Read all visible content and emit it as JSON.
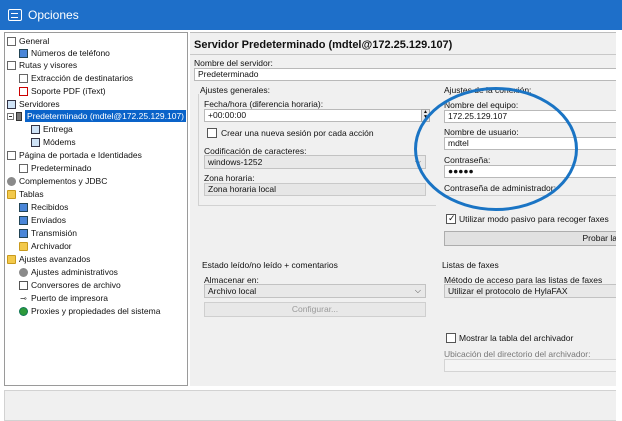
{
  "window": {
    "title": "Opciones"
  },
  "tree": {
    "items": [
      {
        "label": "General",
        "icon": "settings-page-icon"
      },
      {
        "label": "Números de teléfono",
        "icon": "phone-book-icon"
      },
      {
        "label": "Rutas y visores",
        "icon": "route-icon"
      },
      {
        "label": "Extracción de destinatarios",
        "icon": "extract-icon"
      },
      {
        "label": "Soporte PDF (iText)",
        "icon": "pdf-icon"
      },
      {
        "label": "Servidores",
        "icon": "servers-icon"
      },
      {
        "label": "Predeterminado (mdtel@172.25.129.107)",
        "icon": "server-icon"
      },
      {
        "label": "Entrega",
        "icon": "delivery-icon"
      },
      {
        "label": "Módems",
        "icon": "modem-icon"
      },
      {
        "label": "Página de portada e Identidades",
        "icon": "cover-page-icon"
      },
      {
        "label": "Predeterminado",
        "icon": "identity-icon"
      },
      {
        "label": "Complementos y JDBC",
        "icon": "plugin-icon"
      },
      {
        "label": "Tablas",
        "icon": "folder-icon"
      },
      {
        "label": "Recibidos",
        "icon": "received-icon"
      },
      {
        "label": "Enviados",
        "icon": "sent-icon"
      },
      {
        "label": "Transmisión",
        "icon": "transmission-icon"
      },
      {
        "label": "Archivador",
        "icon": "archive-folder-icon"
      },
      {
        "label": "Ajustes avanzados",
        "icon": "folder-icon"
      },
      {
        "label": "Ajustes administrativos",
        "icon": "admin-gear-icon"
      },
      {
        "label": "Conversores de archivo",
        "icon": "pdf-ps-icon"
      },
      {
        "label": "Puerto de impresora",
        "icon": "printer-port-icon"
      },
      {
        "label": "Proxies y propiedades del sistema",
        "icon": "globe-icon"
      }
    ]
  },
  "main": {
    "title": "Servidor Predeterminado (mdtel@172.25.129.107)",
    "server_name_label": "Nombre del servidor:",
    "server_name_value": "Predeterminado",
    "general": {
      "group_label": "Ajustes generales:",
      "datetime_label": "Fecha/hora (diferencia horaria):",
      "datetime_value": "+00:00:00",
      "new_session_label": "Crear una nueva sesión por cada acción",
      "encoding_label": "Codificación de caracteres:",
      "encoding_value": "windows-1252",
      "timezone_label": "Zona horaria:",
      "timezone_value": "Zona horaria local"
    },
    "connection": {
      "group_label": "Ajustes de la conexión:",
      "host_label": "Nombre del equipo:",
      "host_value": "172.25.129.107",
      "user_label": "Nombre de usuario:",
      "user_value": "mdtel",
      "password_label": "Contraseña:",
      "password_value": "●●●●●",
      "admin_password_label": "Contraseña de administrador:",
      "passive_label": "Utilizar modo pasivo para recoger faxes",
      "test_button": "Probar la"
    },
    "read_status": {
      "group_label": "Estado leído/no leído + comentarios",
      "storage_label": "Almacenar en:",
      "storage_value": "Archivo local",
      "configure_button": "Configurar..."
    },
    "fax_lists": {
      "group_label": "Listas de faxes",
      "access_label": "Método de acceso para las listas de faxes",
      "access_value": "Utilizar el protocolo de HylaFAX",
      "show_archive_label": "Mostrar la tabla del archivador",
      "archive_dir_label": "Ubicación del directorio del archivador:"
    }
  },
  "colors": {
    "titlebar": "#1e6fc9",
    "selection": "#0a63c9",
    "annotation": "#1a74c4"
  }
}
